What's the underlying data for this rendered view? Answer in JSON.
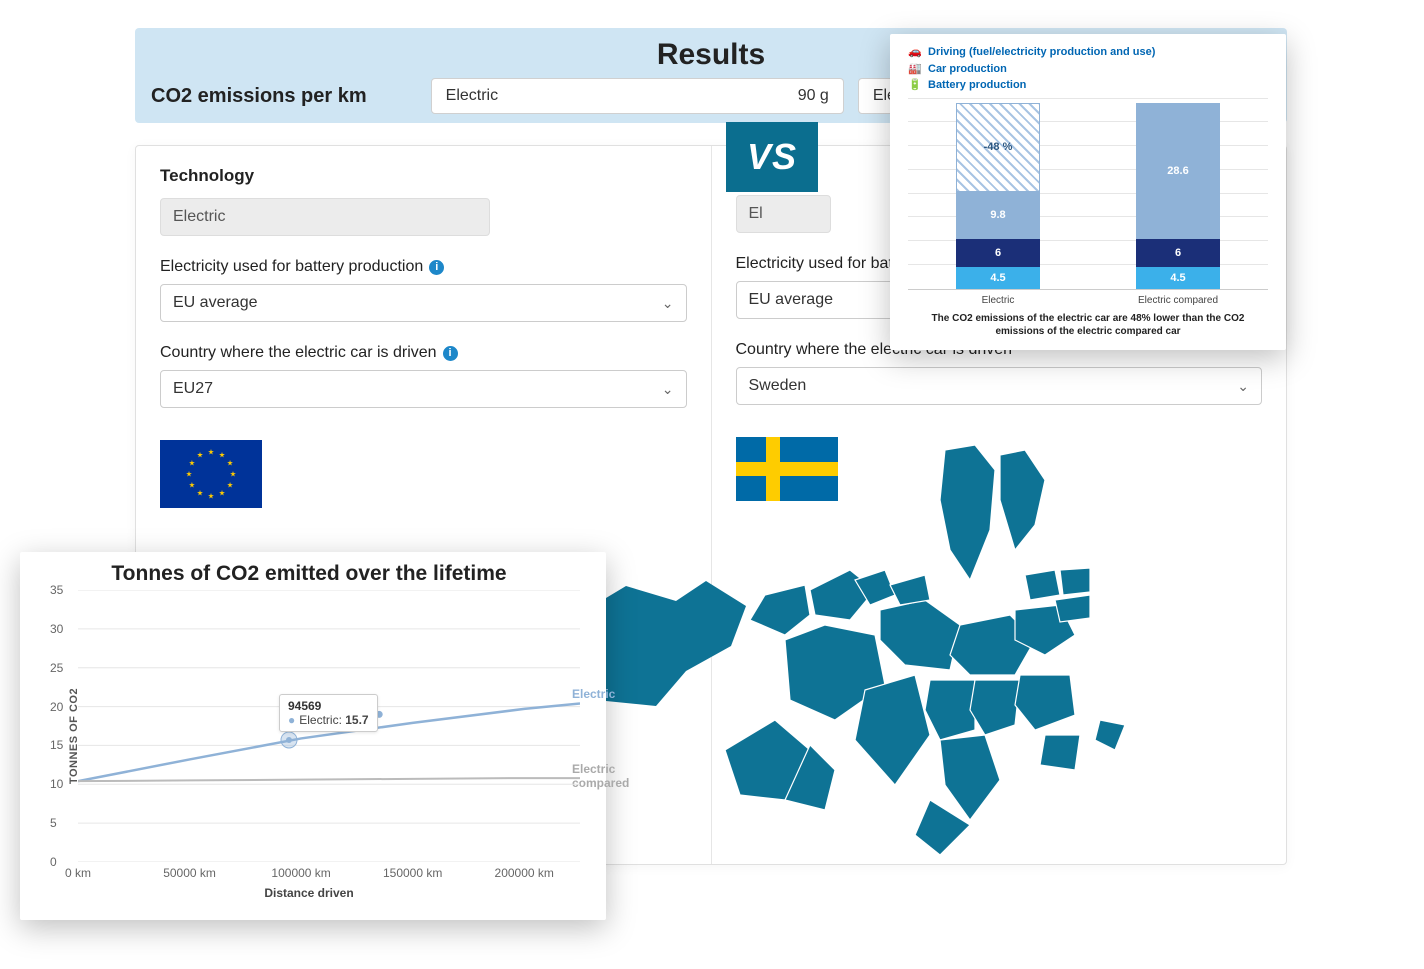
{
  "header": {
    "title": "Results",
    "label": "CO2 emissions per km",
    "left_result_name": "Electric",
    "left_result_value": "90 g",
    "right_result_name": "Electric compar"
  },
  "vs_label": "VS",
  "panels": {
    "technology_heading": "Technology",
    "batt_label": "Electricity used for battery production",
    "drive_label": "Country where the electric car is driven",
    "left": {
      "tech_value": "Electric",
      "batt_value": "EU average",
      "country_value": "EU27"
    },
    "right": {
      "tech_value": "El",
      "batt_value": "EU average",
      "country_value": "Sweden"
    }
  },
  "chart_data": [
    {
      "type": "bar",
      "legend": {
        "driving": "Driving (fuel/electricity production and use)",
        "car": "Car production",
        "battery": "Battery production"
      },
      "stack_keys": [
        "battery",
        "car",
        "driving"
      ],
      "categories": [
        "Electric",
        "Electric compared"
      ],
      "series": [
        {
          "name": "Driving (fuel/electricity production and use)",
          "key": "driving",
          "values": [
            9.8,
            28.6
          ]
        },
        {
          "name": "Car production",
          "key": "car",
          "values": [
            6,
            6
          ]
        },
        {
          "name": "Battery production",
          "key": "battery",
          "values": [
            4.5,
            4.5
          ]
        }
      ],
      "savings_label": "-48 %",
      "caption": "The CO2 emissions of the electric car are 48% lower than the CO2 emissions of the electric compared car",
      "ylim": [
        0,
        40
      ]
    },
    {
      "type": "line",
      "title": "Tonnes of CO2 emitted over the lifetime",
      "xlabel": "Distance driven",
      "ylabel": "TONNES OF CO2",
      "x": [
        0,
        50000,
        100000,
        150000,
        200000,
        225000
      ],
      "xtick_labels": [
        "0 km",
        "50000 km",
        "100000 km",
        "150000 km",
        "200000 km"
      ],
      "series": [
        {
          "name": "Electric",
          "values": [
            10.4,
            13.2,
            15.9,
            17.9,
            19.7,
            20.4
          ]
        },
        {
          "name": "Electric compared",
          "values": [
            10.4,
            10.5,
            10.6,
            10.7,
            10.8,
            10.8
          ]
        }
      ],
      "yticks": [
        0,
        5,
        10,
        15,
        20,
        25,
        30,
        35
      ],
      "ylim": [
        0,
        35
      ],
      "xlim": [
        0,
        225000
      ],
      "tooltip": {
        "x": 94569,
        "series": "Electric",
        "value": 15.7,
        "x_label": "94569",
        "value_label": "15.7"
      },
      "extra_dots": [
        {
          "series": "Electric",
          "x": 128000,
          "y": 18.8
        },
        {
          "series": "Electric",
          "x": 135000,
          "y": 19.0
        }
      ]
    }
  ]
}
